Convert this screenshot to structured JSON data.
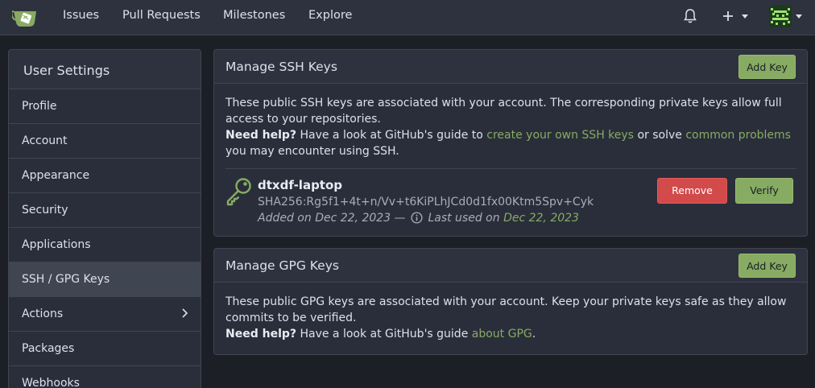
{
  "nav": {
    "links": [
      "Issues",
      "Pull Requests",
      "Milestones",
      "Explore"
    ],
    "logo_icon": "gitea-teacup-icon",
    "notification_icon": "bell-icon",
    "create_icon": "plus-icon",
    "avatar_icon": "user-avatar"
  },
  "sidebar": {
    "title": "User Settings",
    "items": [
      {
        "label": "Profile"
      },
      {
        "label": "Account"
      },
      {
        "label": "Appearance"
      },
      {
        "label": "Security"
      },
      {
        "label": "Applications"
      },
      {
        "label": "SSH / GPG Keys",
        "active": true
      },
      {
        "label": "Actions",
        "has_submenu": true
      },
      {
        "label": "Packages"
      },
      {
        "label": "Webhooks"
      }
    ]
  },
  "ssh": {
    "title": "Manage SSH Keys",
    "add_label": "Add Key",
    "desc": "These public SSH keys are associated with your account. The corresponding private keys allow full access to your repositories.",
    "help_label": "Need help?",
    "help_pre": "Have a look at GitHub's guide to",
    "help_link1": "create your own SSH keys",
    "help_mid": "or solve",
    "help_link2": "common problems",
    "help_post": "you may encounter using SSH.",
    "key": {
      "name": "dtxdf-laptop",
      "fingerprint": "SHA256:Rg5f1+4t+n/Vv+t6KiPLhJCd0d1fx00Ktm5Spv+Cyk",
      "added": "Added on Dec 22, 2023 —",
      "last_used_label": "Last used on",
      "last_used_date": "Dec 22, 2023",
      "remove_label": "Remove",
      "verify_label": "Verify"
    }
  },
  "gpg": {
    "title": "Manage GPG Keys",
    "add_label": "Add Key",
    "desc": "These public GPG keys are associated with your account. Keep your private keys safe as they allow commits to be verified.",
    "help_label": "Need help?",
    "help_pre": "Have a look at GitHub's guide",
    "help_link": "about GPG",
    "help_post": "."
  },
  "colors": {
    "accent": "#87ab63",
    "danger": "#d24a4a",
    "background": "#1c1f25",
    "panel": "#2a2e3a"
  }
}
